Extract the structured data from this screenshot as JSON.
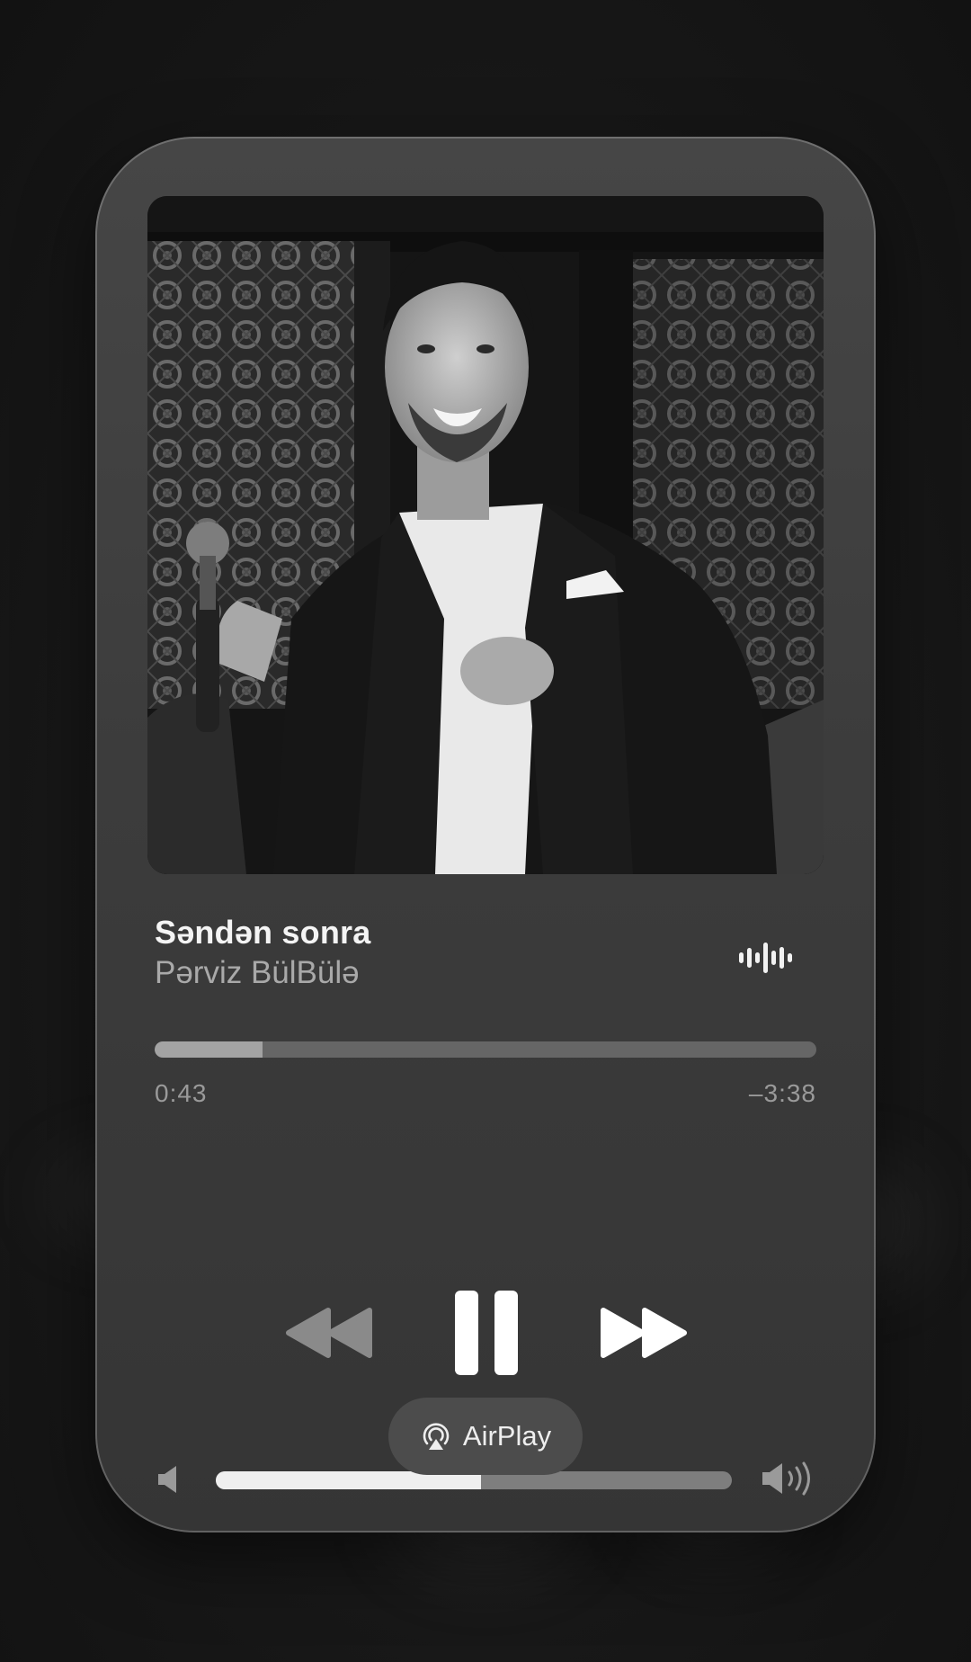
{
  "player": {
    "track_title": "Səndən sonra",
    "artist": "Pərviz BülBülə",
    "progress": {
      "elapsed": "0:43",
      "remaining": "–3:38",
      "fraction": 0.163
    },
    "volume_fraction": 0.514,
    "airplay_label": "AirPlay"
  },
  "icons": {
    "now_playing": "waveform-icon",
    "rewind": "rewind-icon",
    "pause": "pause-icon",
    "forward": "fast-forward-icon",
    "volume_low": "speaker-low-icon",
    "volume_high": "speaker-high-icon",
    "airplay": "airplay-icon"
  },
  "colors": {
    "background": "#151515",
    "card": "#3f3f3f",
    "title_text": "#f4f4f4",
    "secondary_text": "#a9a9a9",
    "progress_fill": "#a3a3a3",
    "volume_fill": "#efefef"
  }
}
